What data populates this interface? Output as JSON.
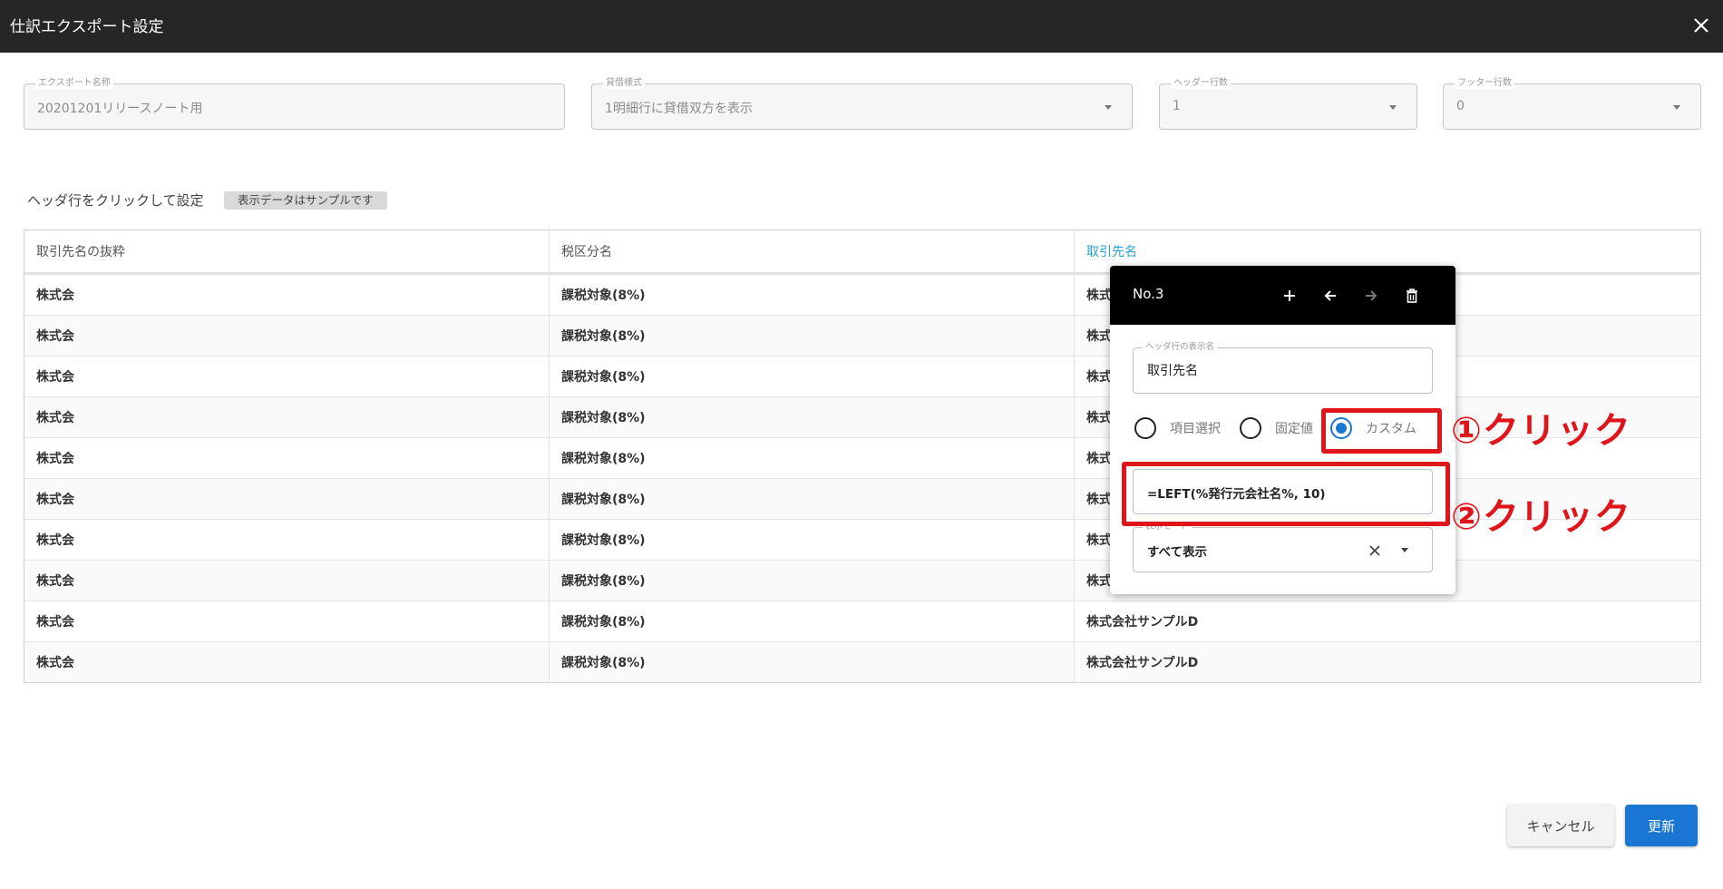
{
  "dialog": {
    "title": "仕訳エクスポート設定"
  },
  "fields": [
    {
      "label": "エクスポート名称",
      "value": "20201201リリースノート用"
    },
    {
      "label": "貸借様式",
      "value": "1明細行に貸借双方を表示"
    },
    {
      "label": "ヘッダー行数",
      "value": "1"
    },
    {
      "label": "フッター行数",
      "value": "0"
    }
  ],
  "hint": "ヘッダ行をクリックして設定",
  "sample_chip": "表示データはサンプルです",
  "table": {
    "headers": [
      "取引先名の抜粋",
      "税区分名",
      "取引先名"
    ],
    "rows": [
      [
        "株式会",
        "課税対象(8%)",
        "株式"
      ],
      [
        "株式会",
        "課税対象(8%)",
        "株式"
      ],
      [
        "株式会",
        "課税対象(8%)",
        "株式"
      ],
      [
        "株式会",
        "課税対象(8%)",
        "株式"
      ],
      [
        "株式会",
        "課税対象(8%)",
        "株式"
      ],
      [
        "株式会",
        "課税対象(8%)",
        "株式"
      ],
      [
        "株式会",
        "課税対象(8%)",
        "株式"
      ],
      [
        "株式会",
        "課税対象(8%)",
        "株式"
      ],
      [
        "株式会",
        "課税対象(8%)",
        "株式会社サンプルD"
      ],
      [
        "株式会",
        "課税対象(8%)",
        "株式会社サンプルD"
      ]
    ]
  },
  "popup": {
    "number": "No.3",
    "display_name_label": "ヘッダ行の表示名",
    "display_name_value": "取引先名",
    "radios": [
      "項目選択",
      "固定値",
      "カスタム"
    ],
    "selected_radio": "カスタム",
    "formula": "=LEFT(%発行元会社名%, 10)",
    "mode_label": "表示モード",
    "mode_value": "すべて表示"
  },
  "annotations": [
    "①クリック",
    "②クリック"
  ],
  "buttons": {
    "cancel": "キャンセル",
    "update": "更新"
  },
  "colors": {
    "accent": "#1976d2",
    "annotation": "#e0141b",
    "titlebar": "#262626",
    "active_header": "#23a4d8"
  }
}
